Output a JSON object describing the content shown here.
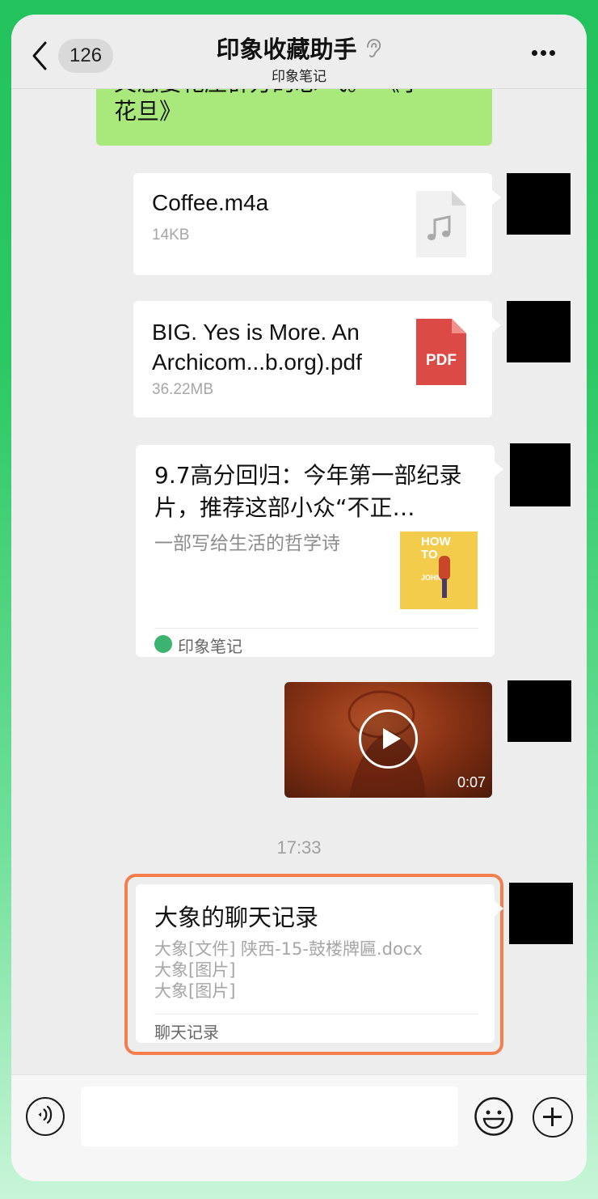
{
  "header": {
    "back_count": "126",
    "title": "印象收藏助手",
    "subtitle": "印象笔记"
  },
  "messages": {
    "partial_text": {
      "line1": "又怎要花压群方的芯 飞。 《小",
      "line2": "花旦》"
    },
    "audio_file": {
      "name": "Coffee.m4a",
      "size": "14KB",
      "icon": "music-note-icon"
    },
    "pdf_file": {
      "name_line1": "BIG. Yes is More. An",
      "name_line2": "Archicom...b.org).pdf",
      "size": "36.22MB",
      "icon_label": "PDF",
      "icon_color": "#dc4a45"
    },
    "article": {
      "title": "9.7高分回归：今年第一部纪录片，推荐这部小众“不正…",
      "description": "一部写给生活的哲学诗",
      "thumb_text_1": "HOW",
      "thumb_text_2": "TO",
      "thumb_text_3": "JOHN",
      "source": "印象笔记"
    },
    "video": {
      "duration": "0:07"
    },
    "timestamp": "17:33",
    "chat_record": {
      "title": "大象的聊天记录",
      "lines": [
        "大象[文件] 陕西-15-鼓楼牌匾.docx",
        "大象[图片]",
        "大象[图片]"
      ],
      "footer": "聊天记录"
    }
  },
  "bottom_bar": {
    "voice_icon": "voice-icon",
    "emoji_icon": "emoji-icon",
    "plus_icon": "plus-icon",
    "input_value": ""
  },
  "colors": {
    "frame_accent": "#22c25c",
    "sent_bubble": "#a9e97b",
    "highlight_border": "#f47e4c"
  }
}
